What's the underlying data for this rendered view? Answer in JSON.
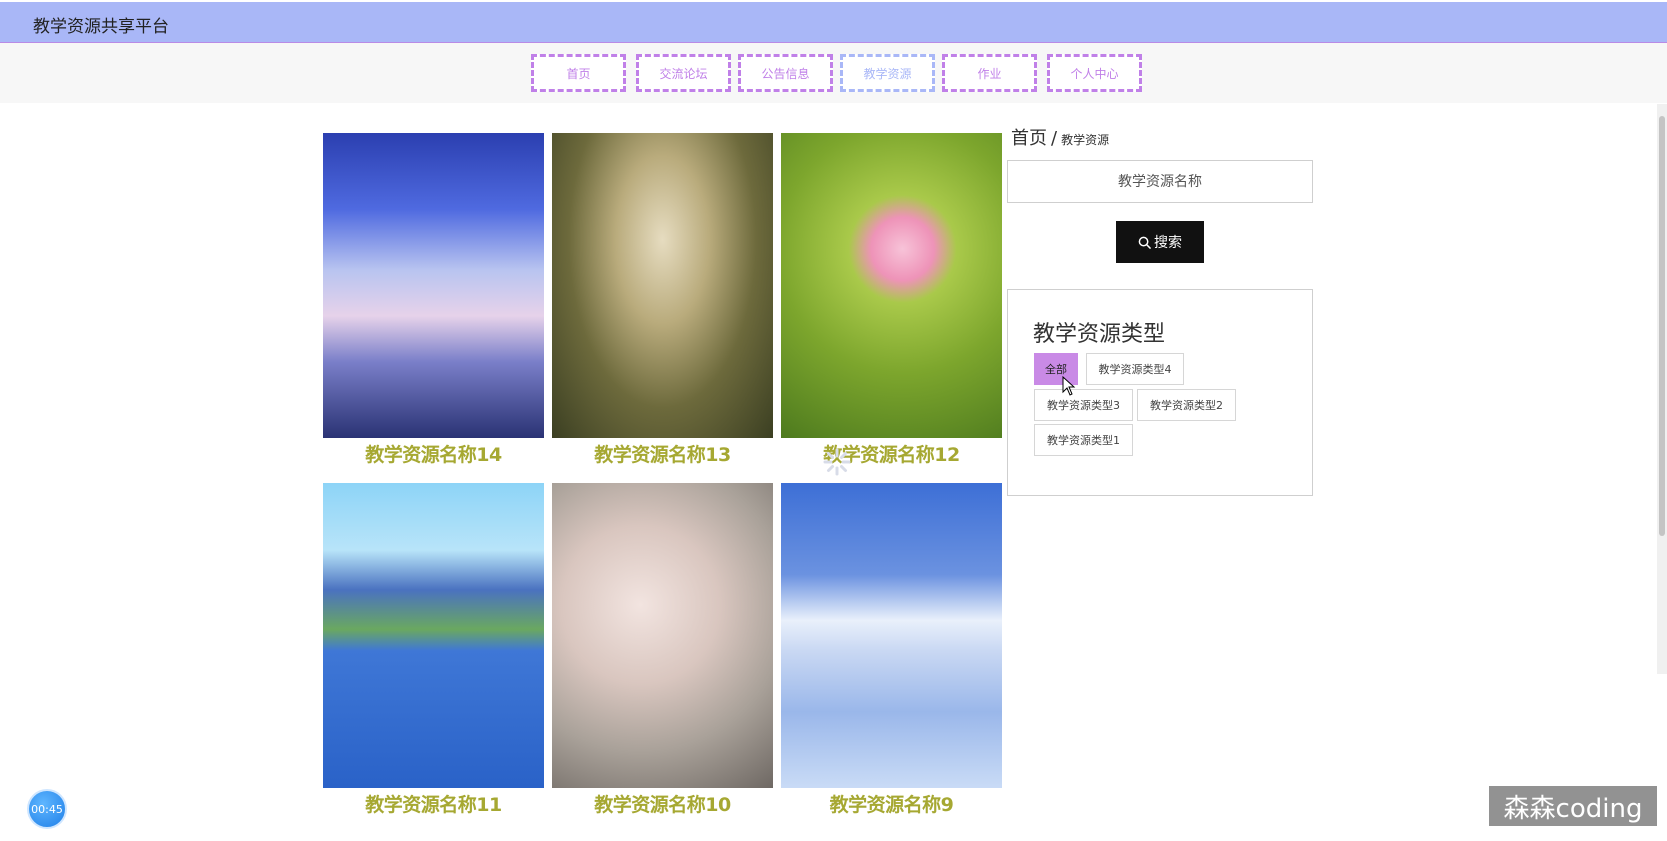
{
  "app": {
    "title": "教学资源共享平台"
  },
  "nav": [
    {
      "label": "首页",
      "active": false
    },
    {
      "label": "交流论坛",
      "active": false
    },
    {
      "label": "公告信息",
      "active": false
    },
    {
      "label": "教学资源",
      "active": true
    },
    {
      "label": "作业",
      "active": false
    },
    {
      "label": "个人中心",
      "active": false
    }
  ],
  "resources": [
    {
      "name": "教学资源名称14"
    },
    {
      "name": "教学资源名称13"
    },
    {
      "name": "教学资源名称12"
    },
    {
      "name": "教学资源名称11"
    },
    {
      "name": "教学资源名称10"
    },
    {
      "name": "教学资源名称9"
    }
  ],
  "breadcrumb": {
    "home": "首页",
    "separator": "/",
    "current": "教学资源"
  },
  "search": {
    "placeholder": "教学资源名称",
    "button_label": "搜索",
    "icon": "search-icon"
  },
  "types": {
    "title": "教学资源类型",
    "items": [
      {
        "label": "全部",
        "active": true
      },
      {
        "label": "教学资源类型4",
        "active": false
      },
      {
        "label": "教学资源类型3",
        "active": false
      },
      {
        "label": "教学资源类型2",
        "active": false
      },
      {
        "label": "教学资源类型1",
        "active": false
      }
    ]
  },
  "timer": {
    "value": "00:45"
  },
  "watermark": {
    "text": "森森coding"
  },
  "colors": {
    "header_bg": "#a9b7f7",
    "nav_border": "#c080e8",
    "nav_active": "#a9b7f7",
    "resource_name": "#a6a832",
    "tag_active": "#c98ae6",
    "search_btn": "#111111"
  }
}
